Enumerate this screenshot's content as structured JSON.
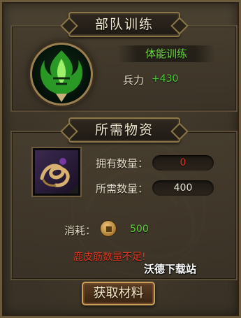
{
  "header_training": "部队训练",
  "training": {
    "name": "体能训练",
    "stat_label": "兵力",
    "stat_value": "+430"
  },
  "header_materials": "所需物资",
  "materials": {
    "owned_label": "拥有数量：",
    "owned_value": "0",
    "required_label": "所需数量：",
    "required_value": "400"
  },
  "cost": {
    "label": "消耗：",
    "value": "500",
    "icon": "copper-coin-icon"
  },
  "warning": "鹿皮筋数量不足!",
  "watermark": "沃德下载站",
  "button_label": "获取材料",
  "colors": {
    "green_text": "#5ed23a",
    "red_text": "#e0372a",
    "frame_gold": "#8c7748"
  }
}
